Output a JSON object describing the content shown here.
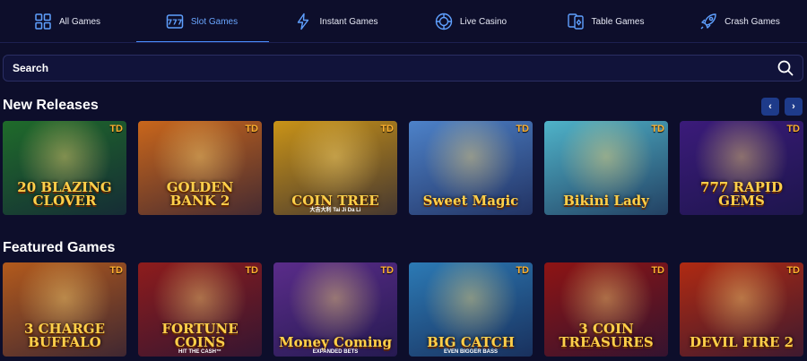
{
  "tabs": [
    {
      "label": "All Games",
      "icon": "grid-icon"
    },
    {
      "label": "Slot Games",
      "icon": "slot-777-icon"
    },
    {
      "label": "Instant Games",
      "icon": "lightning-icon"
    },
    {
      "label": "Live Casino",
      "icon": "chip-icon"
    },
    {
      "label": "Table Games",
      "icon": "cards-icon"
    },
    {
      "label": "Crash Games",
      "icon": "rocket-icon"
    }
  ],
  "active_tab": "Slot Games",
  "search": {
    "label": "Search",
    "icon": "search-icon"
  },
  "sections": {
    "new_releases": {
      "title": "New Releases",
      "prev": "‹",
      "next": "›",
      "games": [
        {
          "title": "20 BLAZING CLOVER",
          "badge": "TD",
          "sub": "",
          "bg": "#1f6b2a"
        },
        {
          "title": "GOLDEN BANK 2",
          "badge": "TD",
          "sub": "",
          "bg": "#c9661b"
        },
        {
          "title": "COIN TREE",
          "badge": "TD",
          "sub": "大吉大利 Tai Ji Da Li",
          "bg": "#c99317"
        },
        {
          "title": "Sweet Magic",
          "badge": "TD",
          "sub": "",
          "bg": "#4d82c9"
        },
        {
          "title": "Bikini Lady",
          "badge": "TD",
          "sub": "",
          "bg": "#4fb3c9"
        },
        {
          "title": "777 RAPID GEMS",
          "badge": "TD",
          "sub": "",
          "bg": "#3b1b7a"
        }
      ]
    },
    "featured": {
      "title": "Featured Games",
      "games": [
        {
          "title": "3 CHARGE BUFFALO",
          "badge": "TD",
          "sub": "",
          "bg": "#b35a1c"
        },
        {
          "title": "FORTUNE COINS",
          "badge": "TD",
          "sub": "HIT THE CASH™",
          "bg": "#8e1c1c"
        },
        {
          "title": "Money Coming",
          "badge": "TD",
          "sub": "EXPANDED BETS",
          "bg": "#5a2c8a"
        },
        {
          "title": "BIG CATCH",
          "badge": "TD",
          "sub": "EVEN BIGGER BASS",
          "bg": "#2c7ab5"
        },
        {
          "title": "3 COIN TREASURES",
          "badge": "TD",
          "sub": "",
          "bg": "#8e1414"
        },
        {
          "title": "DEVIL FIRE 2",
          "badge": "TD",
          "sub": "",
          "bg": "#b02a12"
        }
      ]
    }
  },
  "colors": {
    "background": "#0d0e2b",
    "accent": "#4b8fff",
    "badge": "#ffb02e"
  }
}
